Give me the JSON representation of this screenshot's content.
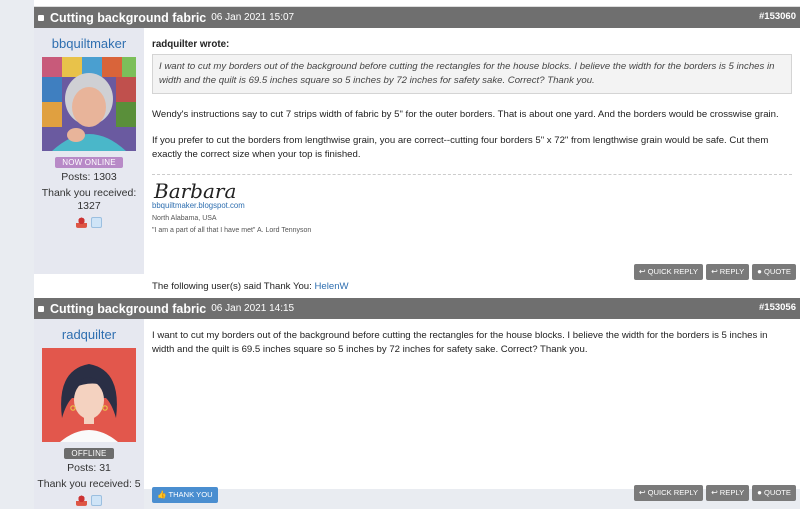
{
  "posts": [
    {
      "title": "Cutting background fabric",
      "date": "06 Jan 2021 15:07",
      "number": "#153060",
      "author": "bbquiltmaker",
      "status": "NOW ONLINE",
      "posts_stat": "Posts: 1303",
      "thanks_stat": "Thank you received: 1327",
      "quote_label": "radquilter wrote:",
      "quote_text": "I want to cut my borders out of the background before cutting the rectangles for the house blocks. I believe the width for the borders is 5 inches in width and the quilt is 69.5 inches square so 5 inches by 72 inches for safety sake. Correct? Thank you.",
      "para1": "Wendy's instructions say to cut 7 strips width of fabric by 5\" for the outer borders. That is about one yard. And the borders would be crosswise grain.",
      "para2": "If you prefer to cut the borders from lengthwise grain, you are correct--cutting four borders 5\" x 72\" from lengthwise grain would be safe. Cut them exactly the correct size when your top is finished.",
      "signature": {
        "name": "Barbara",
        "link": "bbquiltmaker.blogspot.com",
        "location": "North Alabama, USA",
        "quote": "\"I am a part of all that I have met\" A. Lord Tennyson"
      },
      "thanks_line_prefix": "The following user(s) said Thank You:",
      "thanks_user": "HelenW"
    },
    {
      "title": "Cutting background fabric",
      "date": "06 Jan 2021 14:15",
      "number": "#153056",
      "author": "radquilter",
      "status": "OFFLINE",
      "posts_stat": "Posts: 31",
      "thanks_stat": "Thank you received: 5",
      "body": "I want to cut my borders out of the background before cutting the rectangles for the house blocks. I believe the width for the borders is 5 inches in width and the quilt is 69.5 inches square so 5 inches by 72 inches for safety sake. Correct? Thank you.",
      "thank_button": "THANK YOU"
    }
  ],
  "actions": {
    "quick_reply": "QUICK REPLY",
    "reply": "REPLY",
    "quote": "QUOTE"
  }
}
